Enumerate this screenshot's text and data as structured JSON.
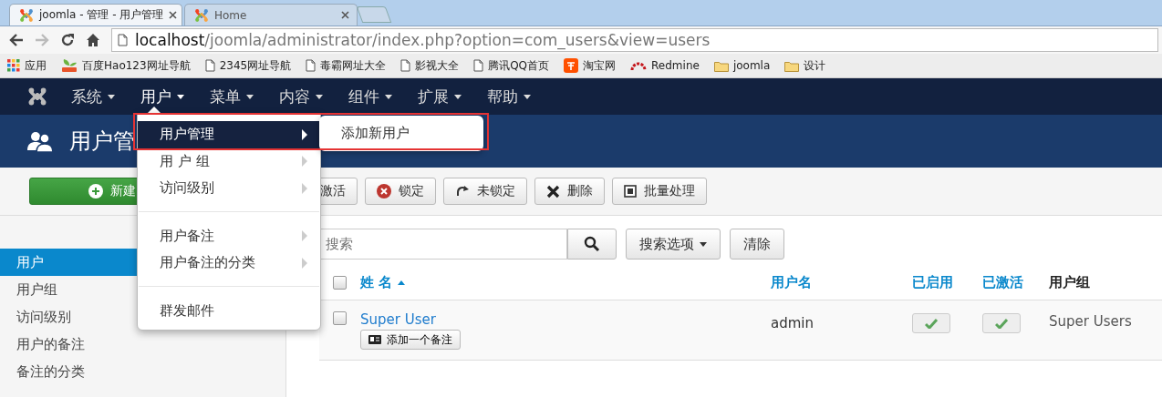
{
  "browser": {
    "tabs": [
      {
        "title": "joomla - 管理 - 用户管理",
        "selected": true
      },
      {
        "title": "Home",
        "selected": false
      }
    ],
    "url_host": "localhost",
    "url_path": "/joomla/administrator/index.php?option=com_users&view=users",
    "bookmarks": [
      {
        "label": "应用",
        "kind": "apps"
      },
      {
        "label": "百度Hao123网址导航",
        "kind": "hao"
      },
      {
        "label": "2345网址导航",
        "kind": "page"
      },
      {
        "label": "毒霸网址大全",
        "kind": "page"
      },
      {
        "label": "影视大全",
        "kind": "page"
      },
      {
        "label": "腾讯QQ首页",
        "kind": "page"
      },
      {
        "label": "淘宝网",
        "kind": "taobao"
      },
      {
        "label": "Redmine",
        "kind": "redmine"
      },
      {
        "label": "joomla",
        "kind": "folder"
      },
      {
        "label": "设计",
        "kind": "folder"
      }
    ]
  },
  "nav": {
    "items": [
      {
        "label": "系统",
        "selected": false
      },
      {
        "label": "用户",
        "selected": true
      },
      {
        "label": "菜单",
        "selected": false
      },
      {
        "label": "内容",
        "selected": false
      },
      {
        "label": "组件",
        "selected": false
      },
      {
        "label": "扩展",
        "selected": false
      },
      {
        "label": "帮助",
        "selected": false
      }
    ]
  },
  "dropdown": {
    "highlight_frame": true,
    "groups": [
      {
        "items": [
          {
            "label": "用户管理",
            "selected": true,
            "has_submenu": true,
            "submenu": [
              "添加新用户"
            ]
          },
          {
            "label": "用 户 组",
            "selected": false,
            "has_submenu": true
          },
          {
            "label": "访问级别",
            "selected": false,
            "has_submenu": true
          }
        ]
      },
      {
        "items": [
          {
            "label": "用户备注",
            "selected": false,
            "has_submenu": true
          },
          {
            "label": "用户备注的分类",
            "selected": false,
            "has_submenu": true
          }
        ]
      },
      {
        "items": [
          {
            "label": "群发邮件",
            "selected": false,
            "has_submenu": false
          }
        ]
      }
    ]
  },
  "page_title": "用户管",
  "toolbar": [
    {
      "label": "新建",
      "kind": "new"
    },
    {
      "label": "激活",
      "kind": "activate"
    },
    {
      "label": "锁定",
      "kind": "block"
    },
    {
      "label": "未锁定",
      "kind": "unblock"
    },
    {
      "label": "删除",
      "kind": "delete"
    },
    {
      "label": "批量处理",
      "kind": "batch"
    }
  ],
  "sidebar": {
    "items": [
      {
        "label": "用户",
        "selected": true
      },
      {
        "label": "用户组",
        "selected": false
      },
      {
        "label": "访问级别",
        "selected": false
      },
      {
        "label": "用户的备注",
        "selected": false
      },
      {
        "label": "备注的分类",
        "selected": false
      }
    ]
  },
  "filter": {
    "placeholder": "搜索",
    "options_button": "搜索选项",
    "clear_button": "清除"
  },
  "table": {
    "select_all_checked": false,
    "columns": [
      {
        "label": "姓 名",
        "sortable": true,
        "sorted": true
      },
      {
        "label": "用户名",
        "sortable": true,
        "sorted": false
      },
      {
        "label": "已启用",
        "sortable": true,
        "sorted": false
      },
      {
        "label": "已激活",
        "sortable": true,
        "sorted": false
      },
      {
        "label": "用户组",
        "sortable": false,
        "sorted": false
      }
    ],
    "rows": [
      {
        "name": "Super User",
        "note_button": "添加一个备注",
        "username": "admin",
        "enabled": true,
        "activated": true,
        "group": "Super Users",
        "checked": false
      }
    ]
  }
}
